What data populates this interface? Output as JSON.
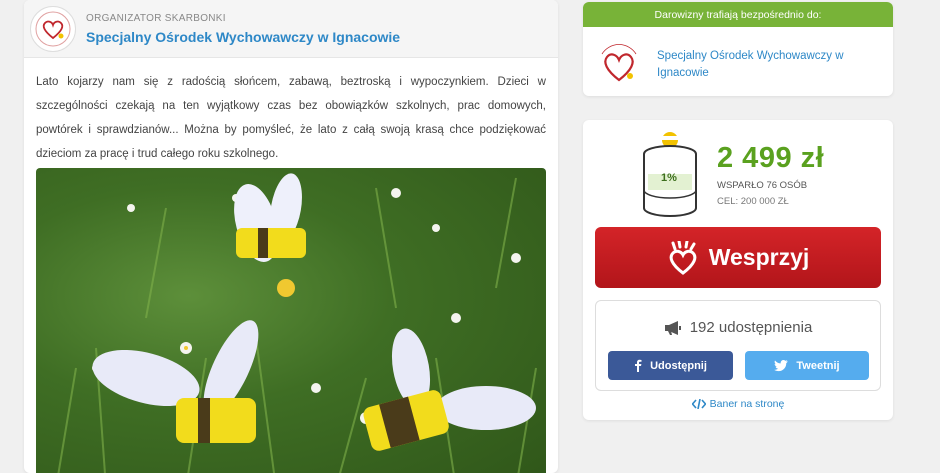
{
  "organizer": {
    "caption": "ORGANIZATOR SKARBONKI",
    "name": "Specjalny Ośrodek Wychowawczy w Ignacowie"
  },
  "description": "Lato kojarzy nam się z radością słońcem, zabawą, beztroską i wypoczynkiem. Dzieci w szczególności czekają na ten wyjątkowy czas bez obowiązków szkolnych, prac domowych, powtórek i sprawdzianów... Można by pomyśleć, że lato z całą swoją krasą chce podziękować dzieciom za pracę i trud całego roku szkolnego.",
  "donations": {
    "header": "Darowizny trafiają bezpośrednio do:",
    "recipient": "Specjalny Ośrodek Wychowawczy w Ignacowie"
  },
  "stats": {
    "percent": "1%",
    "progress_fraction": 0.01,
    "amount": "2 499 zł",
    "supported": "WSPARŁO 76 OSÓB",
    "goal": "CEL: 200 000 ZŁ"
  },
  "support_button": {
    "label": "Wesprzyj"
  },
  "share": {
    "count_text": "192 udostępnienia",
    "facebook_label": "Udostępnij",
    "twitter_label": "Tweetnij",
    "banner_label": "Baner na stronę"
  },
  "colors": {
    "accent_green": "#78b338",
    "amount_green": "#5aa11f",
    "link_blue": "#2e88c7",
    "support_red": "#c81d22",
    "facebook": "#3b5998",
    "twitter": "#55acee"
  },
  "icons": {
    "megaphone": "megaphone-icon",
    "facebook": "facebook-icon",
    "twitter": "twitter-icon",
    "code": "code-icon",
    "heart_hand": "heart-hand-icon",
    "piggy": "piggy-bank-icon"
  }
}
